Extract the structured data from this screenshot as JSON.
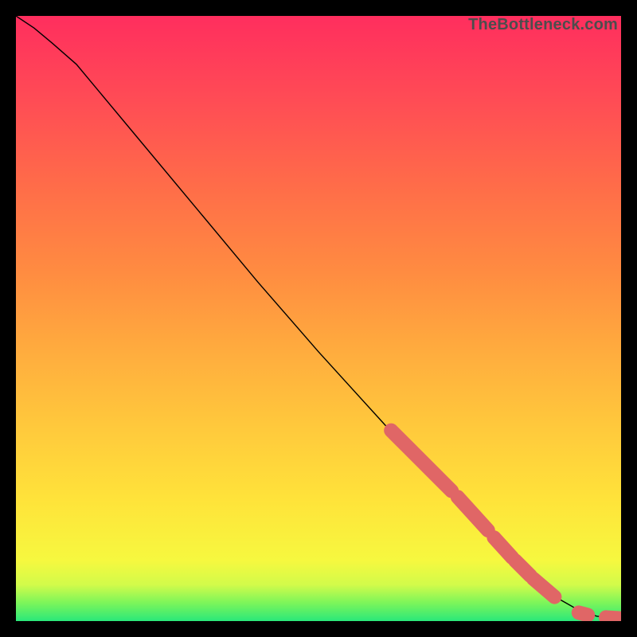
{
  "watermark": "TheBottleneck.com",
  "colors": {
    "series": "#e06666",
    "curve": "#000000",
    "background_top": "#FF2E5E",
    "background_bottom": "#2AE87A"
  },
  "chart_data": {
    "type": "line",
    "title": "",
    "xlabel": "",
    "ylabel": "",
    "xlim": [
      0,
      100
    ],
    "ylim": [
      0,
      100
    ],
    "grid": false,
    "legend": false,
    "series": [
      {
        "name": "curve",
        "kind": "line",
        "x": [
          0,
          3,
          6,
          10,
          20,
          30,
          40,
          50,
          60,
          70,
          80,
          90,
          93,
          96,
          100
        ],
        "y": [
          100,
          98,
          95.5,
          92,
          80,
          68,
          56,
          44.5,
          33.5,
          22.5,
          12,
          3.5,
          1.8,
          0.8,
          0.4
        ]
      },
      {
        "name": "highlighted-points",
        "kind": "scatter",
        "segments": [
          {
            "x": [
              62,
              72
            ],
            "y": [
              31.5,
              21.5
            ]
          },
          {
            "x": [
              73,
              78
            ],
            "y": [
              20.5,
              15
            ]
          },
          {
            "x": [
              79,
              82
            ],
            "y": [
              13.8,
              10.5
            ]
          },
          {
            "x": [
              82.5,
              85
            ],
            "y": [
              10,
              7.5
            ]
          },
          {
            "x": [
              85.5,
              89
            ],
            "y": [
              7,
              4
            ]
          },
          {
            "x": [
              93,
              94.5
            ],
            "y": [
              1.4,
              1
            ]
          },
          {
            "x": [
              97.5,
              100
            ],
            "y": [
              0.6,
              0.45
            ]
          }
        ]
      }
    ]
  }
}
